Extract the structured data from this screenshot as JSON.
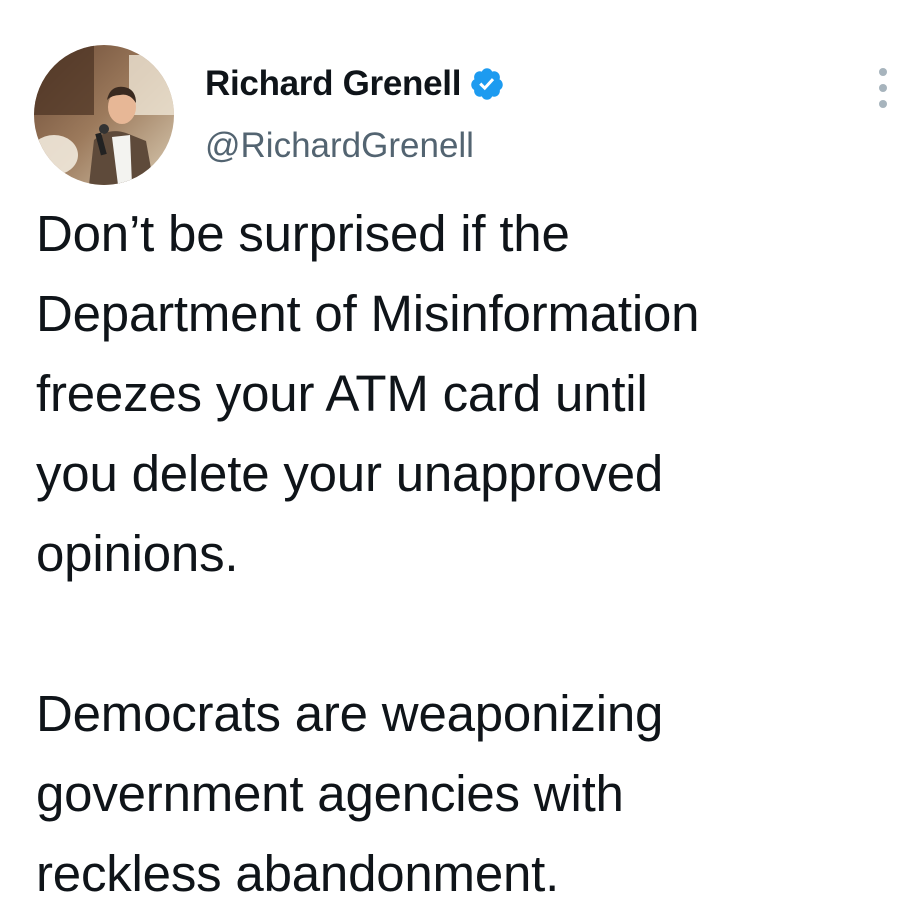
{
  "author": {
    "display_name": "Richard Grenell",
    "handle": "@RichardGrenell",
    "verified": true,
    "verified_color": "#1d9bf0"
  },
  "menu": {
    "icon": "more-vertical-icon"
  },
  "tweet": {
    "paragraphs": [
      "Don’t be surprised if the\nDepartment of Misinformation\nfreezes your ATM card until\nyou delete your unapproved\nopinions.",
      "Democrats are weaponizing\ngovernment agencies with\nreckless abandonment."
    ]
  }
}
